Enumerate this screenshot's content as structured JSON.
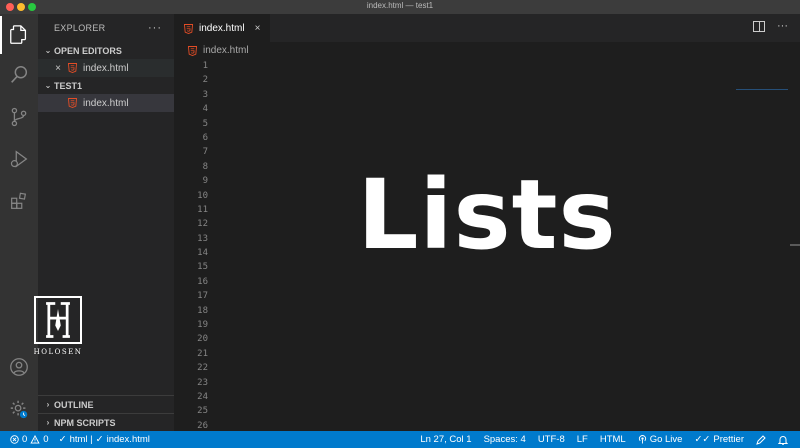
{
  "window": {
    "title": "index.html — test1"
  },
  "activity_bar": {
    "items": [
      "explorer-icon",
      "search-icon",
      "source-control-icon",
      "run-debug-icon",
      "extensions-icon"
    ],
    "bottom": [
      "account-icon",
      "manage-gear-icon"
    ]
  },
  "sidebar": {
    "header": "EXPLORER",
    "more": "···",
    "open_editors": {
      "label": "OPEN EDITORS",
      "files": [
        {
          "name": "index.html"
        }
      ]
    },
    "folder": {
      "label": "TEST1",
      "files": [
        {
          "name": "index.html"
        }
      ]
    },
    "outline_label": "OUTLINE",
    "npm_label": "NPM SCRIPTS"
  },
  "logo": {
    "letter": "H",
    "text": "HOLOSEN"
  },
  "editor": {
    "tab": {
      "label": "index.html",
      "close": "×"
    },
    "more": "···",
    "breadcrumb": "index.html",
    "line_numbers": [
      "1",
      "2",
      "3",
      "4",
      "5",
      "6",
      "7",
      "8",
      "9",
      "10",
      "11",
      "12",
      "13",
      "14",
      "15",
      "16",
      "17",
      "18",
      "19",
      "20",
      "21",
      "22",
      "23",
      "24",
      "25",
      "26"
    ],
    "overlay_title": "Lists"
  },
  "statusbar": {
    "errors": "0",
    "warnings": "0",
    "lang_check": "html | ",
    "file_check": "index.html",
    "position": "Ln 27, Col 1",
    "spaces": "Spaces: 4",
    "encoding": "UTF-8",
    "eol": "LF",
    "language": "HTML",
    "golive": "Go Live",
    "prettier": "Prettier"
  },
  "colors": {
    "accent": "#007acc",
    "html_icon": "#e44d26"
  }
}
